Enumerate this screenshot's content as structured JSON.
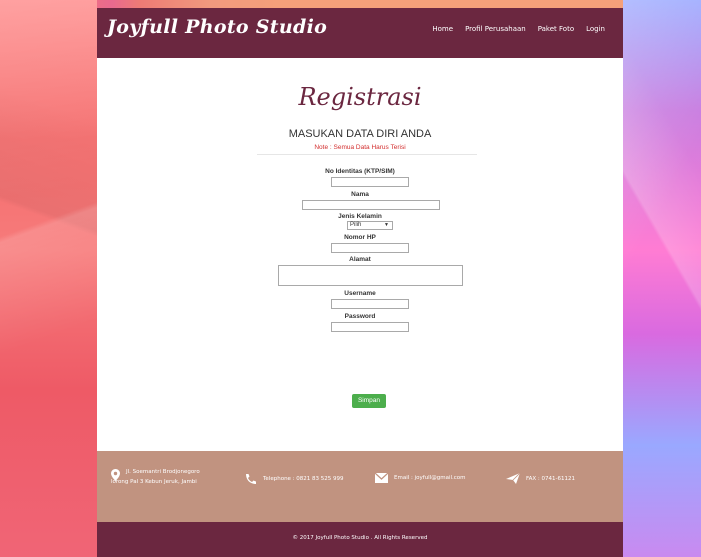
{
  "brand": "Joyfull Photo Studio",
  "nav": [
    "Home",
    "Profil Perusahaan",
    "Paket Foto",
    "Login"
  ],
  "form": {
    "title": "Registrasi",
    "subtitle": "MASUKAN DATA DIRI ANDA",
    "note": "Note : Semua Data Harus Terisi",
    "labels": {
      "id": "No Identitas (KTP/SIM)",
      "nama": "Nama",
      "jenis": "Jenis Kelamin",
      "hp": "Nomor HP",
      "alamat": "Alamat",
      "username": "Username",
      "password": "Password"
    },
    "jenis_selected": "Pilih",
    "submit": "Simpan"
  },
  "footer": {
    "address_line1": "Jl. Soemantri Brodjonegoro",
    "address_line2": "lorong Pal 3 Kebun Jeruk, Jambi",
    "telephone": "Telephone : 0821 83 525 999",
    "email": "Email : joyfull@gmail.com",
    "fax": "FAX : 0741-61121",
    "copyright": "© 2017 Joyfull Photo Studio . All Rights Reserved"
  },
  "colors": {
    "primary": "#6b2740",
    "footer": "#c19380",
    "button": "#4cae4c",
    "note": "#d32f2f"
  }
}
